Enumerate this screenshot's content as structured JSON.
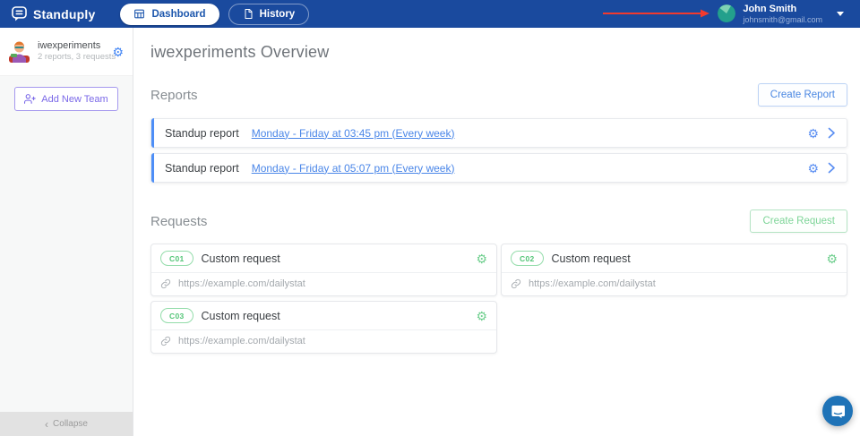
{
  "topbar": {
    "brand": "Standuply",
    "nav": [
      {
        "label": "Dashboard",
        "active": true
      },
      {
        "label": "History",
        "active": false
      }
    ],
    "user": {
      "name": "John Smith",
      "email": "johnsmith@gmail.com"
    }
  },
  "sidebar": {
    "team": {
      "name": "iwexperiments",
      "meta": "2 reports, 3 requests"
    },
    "add_team_label": "Add New Team",
    "collapse_label": "Collapse"
  },
  "main": {
    "title": "iwexperiments Overview",
    "reports": {
      "heading": "Reports",
      "create_label": "Create Report",
      "rows": [
        {
          "label": "Standup report",
          "schedule": "Monday - Friday at 03:45 pm (Every week)"
        },
        {
          "label": "Standup report",
          "schedule": "Monday - Friday at 05:07 pm (Every week)"
        }
      ]
    },
    "requests": {
      "heading": "Requests",
      "create_label": "Create Request",
      "cards": [
        {
          "code": "C01",
          "label": "Custom request",
          "url": "https://example.com/dailystat"
        },
        {
          "code": "C02",
          "label": "Custom request",
          "url": "https://example.com/dailystat"
        },
        {
          "code": "C03",
          "label": "Custom request",
          "url": "https://example.com/dailystat"
        }
      ]
    }
  },
  "icons": {
    "gear": "⚙",
    "chevron_left": "‹"
  },
  "colors": {
    "topbar_bg": "#1a4a9e",
    "accent_blue": "#4d8ef7",
    "link_blue": "#4a86e8",
    "green": "#53c577",
    "purple": "#7a68e8",
    "arrow_red": "#f23a2e",
    "intercom_blue": "#1f73b7"
  }
}
